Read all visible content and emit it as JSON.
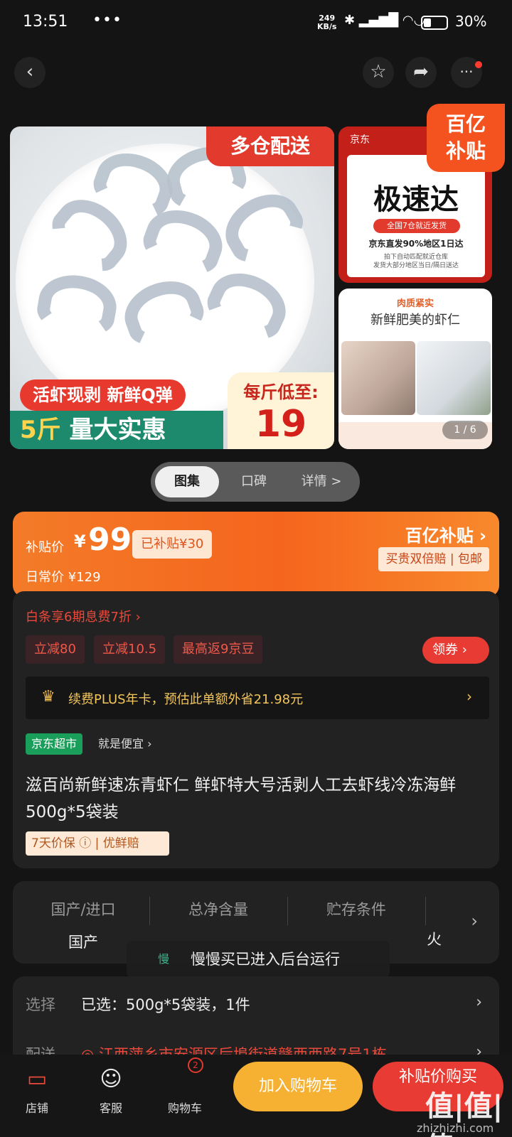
{
  "status": {
    "time": "13:51",
    "dots": "•••",
    "net_speed_top": "249",
    "net_speed_bottom": "KB/s",
    "icons": "✱ ▂▄▆█ ◠◡",
    "battery": "30%"
  },
  "nav": {
    "back": "‹",
    "fav": "☆",
    "share": "➦",
    "more": "···"
  },
  "gallery": {
    "tag_multi": "多仓配送",
    "tag_live": "活虾现剥 新鲜Q弹",
    "tag_5jin_num": "5斤",
    "tag_5jin": "量大实惠",
    "price_label": "每斤低至:",
    "price_value": "19",
    "top_jd": "京东",
    "top_big": "极速达",
    "top_pill": "全国7仓就近发货",
    "top_line1": "京东直发90%地区1日达",
    "top_line2": "拍下自动匹配就近仓库\n发货大部分地区当日/隔日送达",
    "badge_yi": "百亿\n补贴",
    "bot_t1": "肉质紧实",
    "bot_t2": "新鲜肥美的虾仁",
    "counter": "1 / 6"
  },
  "tabs": [
    {
      "label": "图集"
    },
    {
      "label": "口碑"
    },
    {
      "label": "详情 >"
    }
  ],
  "price": {
    "label": "补贴价",
    "currency": "¥",
    "value": "99",
    "subsidy": "已补贴¥30",
    "original": "日常价 ¥129",
    "brand": "百亿补贴 ›",
    "guarantee": "买贵双倍赔 | 包邮"
  },
  "promo": {
    "baitiao": "白条享6期息费7折 ›",
    "coupons": [
      "立减80",
      "立减10.5",
      "最高返9京豆"
    ],
    "get_coupon": "领券 ›",
    "plus_crown": "♛",
    "plus_text": "续费PLUS年卡，预估此单额外省21.98元",
    "plus_arrow": "›",
    "market": "京东超市",
    "market_slogan": "就是便宜 ›",
    "title": "滋百尚新鲜速冻青虾仁 鲜虾特大号活剥人工去虾线冷冻海鲜 500g*5袋装",
    "badge": "7天价保 ⓘ | 优鲜赔"
  },
  "specs": {
    "cols": [
      {
        "h": "国产/进口",
        "v": "国产"
      },
      {
        "h": "总净含量",
        "v": ""
      },
      {
        "h": "贮存条件",
        "v": ""
      }
    ],
    "arrow": "›",
    "cut_value": "火"
  },
  "toast": {
    "icon": "慢",
    "text": "慢慢买已进入后台运行"
  },
  "select": {
    "label": "选择",
    "value": "已选：500g*5袋装，1件",
    "arrow": "›",
    "ship_label": "配送",
    "ship_value": "◎ 江西萍乡市安源区后埠街道赣西西路7号1栋",
    "ship_arrow": "›"
  },
  "bottom": {
    "store_icon": "▭",
    "store": "店铺",
    "service_icon": "☺",
    "service": "客服",
    "cart_icon": "🛒",
    "cart": "购物车",
    "cart_count": "2",
    "add_cart": "加入购物车",
    "buy": "补贴价购买",
    "watermark": "值|值|值",
    "watermark_url": "zhizhizhi.com"
  }
}
